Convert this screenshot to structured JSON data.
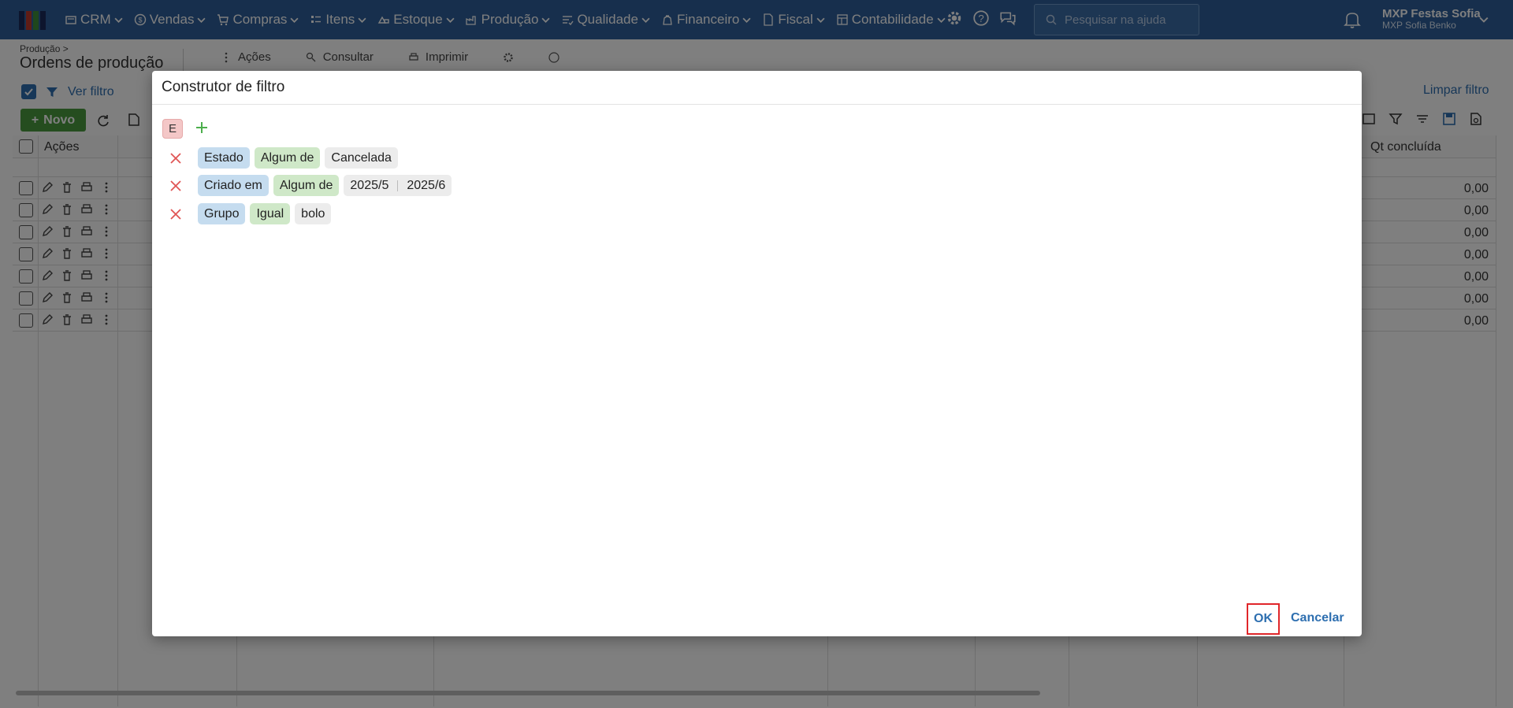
{
  "topbar": {
    "nav": [
      {
        "label": "CRM",
        "icon": "crm-icon"
      },
      {
        "label": "Vendas",
        "icon": "dollar-icon"
      },
      {
        "label": "Compras",
        "icon": "cart-icon"
      },
      {
        "label": "Itens",
        "icon": "items-icon"
      },
      {
        "label": "Estoque",
        "icon": "stock-icon"
      },
      {
        "label": "Produção",
        "icon": "factory-icon"
      },
      {
        "label": "Qualidade",
        "icon": "quality-icon"
      },
      {
        "label": "Financeiro",
        "icon": "finance-icon"
      },
      {
        "label": "Fiscal",
        "icon": "fiscal-icon"
      },
      {
        "label": "Contabilidade",
        "icon": "accounting-icon"
      }
    ],
    "search_placeholder": "Pesquisar na ajuda",
    "user_company": "MXP Festas Sofia",
    "user_name": "MXP Sofia Benko",
    "colors": {
      "bar": "#2e5f9a",
      "accent": "#2e6fb0",
      "green": "#4a9b3f"
    }
  },
  "page": {
    "breadcrumb": "Produção >",
    "title": "Ordens de produção",
    "toolbar": {
      "acoes": "Ações",
      "consultar": "Consultar",
      "imprimir": "Imprimir"
    },
    "ver_filtro": "Ver filtro",
    "limpar_filtro": "Limpar filtro",
    "novo": "Novo",
    "grid": {
      "col_acoes": "Ações",
      "col_qt": "Qt concluída",
      "rows": [
        "0,00",
        "0,00",
        "0,00",
        "0,00",
        "0,00",
        "0,00",
        "0,00"
      ]
    }
  },
  "modal": {
    "title": "Construtor de filtro",
    "group_operator": "E",
    "conditions": [
      {
        "field": "Estado",
        "operator": "Algum de",
        "values": [
          "Cancelada"
        ]
      },
      {
        "field": "Criado em",
        "operator": "Algum de",
        "values": [
          "2025/5",
          "2025/6"
        ]
      },
      {
        "field": "Grupo",
        "operator": "Igual",
        "values": [
          "bolo"
        ]
      }
    ],
    "ok": "OK",
    "cancel": "Cancelar"
  }
}
